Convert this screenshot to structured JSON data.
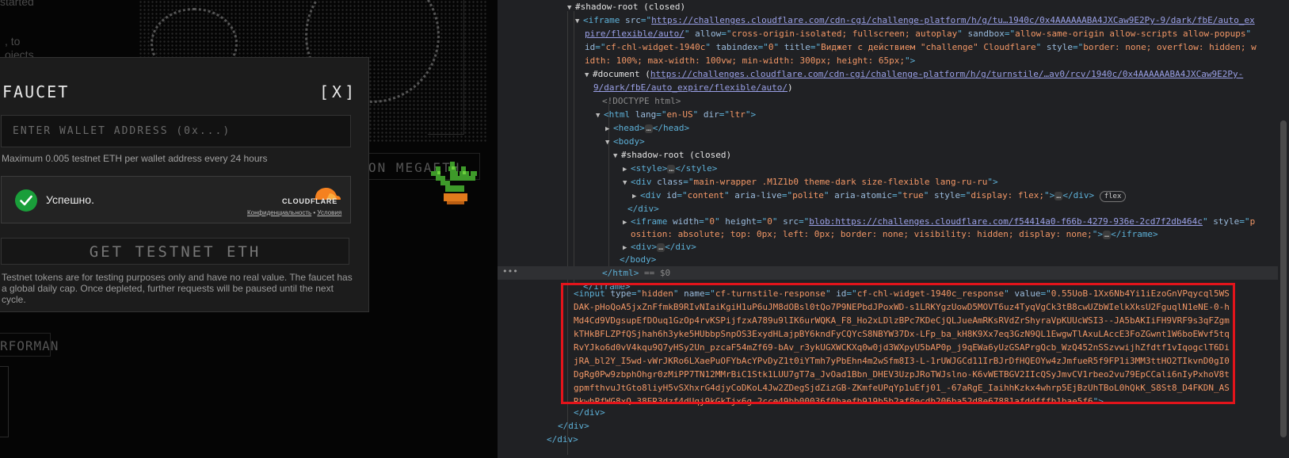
{
  "left_page": {
    "bg_text_a": "started",
    "bg_text_b_line1": ", to",
    "bg_text_b_line2": "ojects",
    "megaeth_button": "ON MEGAETH",
    "perf_button": "RFORMAN",
    "modal": {
      "title": "FAUCET",
      "close_label": "[X]",
      "wallet_placeholder": "ENTER WALLET ADDRESS (0x...)",
      "limit_text": "Maximum 0.005 testnet ETH per wallet address every 24 hours",
      "cf_widget": {
        "status": "Успешно.",
        "logo_text": "CLOUDFLARE",
        "privacy_link": "Конфиденциальность",
        "separator": " • ",
        "terms_link": "Условия"
      },
      "get_button": "GET TESTNET ETH",
      "disclaimer": "Testnet tokens are for testing purposes only and have no real value. The faucet has a global daily cap. Once depleted, further requests will be paused until the next cycle."
    }
  },
  "devtools": {
    "shadow_root_1": "#shadow-root (closed)",
    "iframe_src_1": "https://challenges.cloudflare.com/cdn-cgi/challenge-platform/h/g/tu…1940c/0x4AAAAAABA4JXCaw9E2Py-9/dark/fbE/auto_ex",
    "iframe_src_2": "pire/flexible/auto/",
    "iframe_allow": "cross-origin-isolated; fullscreen; autoplay",
    "iframe_sandbox": "allow-same-origin allow-scripts allow-popups",
    "iframe_id": "cf-chl-widget-1940c",
    "iframe_tabindex": "0",
    "iframe_title": "Виджет с действием \"challenge\" Cloudflare",
    "iframe_style_1": "border: none; overflow: hidden; w",
    "iframe_style_2": "idth: 100%; max-width: 100vw; min-width: 300px; height: 65px;",
    "document_label": "#document",
    "document_url_1": "https://challenges.cloudflare.com/cdn-cgi/challenge-platform/h/g/turnstile/…av0/rcv/1940c/0x4AAAAAABA4JXCaw9E2Py-",
    "document_url_2": "9/dark/fbE/auto_expire/flexible/auto/",
    "doctype": "<!DOCTYPE html>",
    "html_lang": "en-US",
    "html_dir": "ltr",
    "shadow_root_2": "#shadow-root (closed)",
    "div_class": "main-wrapper .M1Z1b0 theme-dark size-flexible lang-ru-ru",
    "content_id": "content",
    "aria_live": "polite",
    "aria_atomic": "true",
    "content_style": "display: flex;",
    "flex_badge": "flex",
    "iframe2_width": "0",
    "iframe2_height": "0",
    "iframe2_src": "blob:https://challenges.cloudflare.com/f54414a0-f66b-4279-936e-2cd7f2db464c",
    "iframe2_style_1": "p",
    "iframe2_style_2": "osition: absolute; top: 0px; left: 0px; border: none; visibility: hidden; display: none;",
    "selected_suffix": " == $0",
    "ellipsis": "…",
    "input": {
      "type": "hidden",
      "name": "cf-turnstile-response",
      "id": "cf-chl-widget-1940c_response",
      "value": "0.55UoB-1Xx6Nb4Yi1iEzoGnVPqycql5WSDAK-pHoQoA5jxZnFfmkB9RIvNIaiKgiH1uP6uJM8dOBsl0tQo7P9NEPbdJPoxWD-s1LRKYgzUowD5MOVT6uz4TyqVgCk3tB8cwUZbWIelkXksU2FguqlN1eNE-0-hMd4Cd9VDgsupEfDOuq1GzOp4rvKSPijfzxA789u9lIK6urWQKA_F8_Ho2xLDlzBPc7KDeCjQLJueAmRKsRVdZrShyraVpKUUcWSI3--JA5bAKIiFH9VRF9s3qFZgmkTHkBFLZPfQSjhah6h3yke5HUbbpSnpOS3ExydHLajpBY6kndFyCQYcS8NBYW37Dx-LFp_ba_kH8K9Xx7eq3GzN9QL1EwgwTlAxuLAccE3FoZGwnt1W6boEWvf5tqRvYJko6d0vV4kqu9Q7yHSy2Un_pzcaF54mZf69-bAv_r3ykUGXWCKXq0w0jd3WXpyU5bAP0p_j9qEWa6yUzGSAPrgQcb_WzQ452nSSzvwijhZfdtf1vIqogclT6DijRA_bl2Y_I5wd-vWrJKRo6LXaePuOFYbAcYPvDyZ1t0iYTmh7yPbEhn4m2wSfm8I3-L-1rUWJGCd11IrBJrDfHQEOYw4zJmfueR5f9FP1i3MM3ttHO2TIkvnD0gI0DgRg0Pw9zbphOhgr0zMiPP7TN12MMrBiC1Stk1LUU7gT7a_JvOad1Bbn_DHEV3UzpJRoTWJslno-K6vWETBGV2IIcQSyJmvCV1rbeo2vu79EpCCali6nIyPxhoV8tgpmfthvuJtGto8liyH5vSXhxrG4djyCoDKoL4Jw2ZDegSjdZizGB-ZKmfeUPqYp1uEfj01_-67aRgE_IaihhKzkx4whrp5EjBzUhTBoL0hQkK_S8St8_D4FKDN_ASRkwhPfWG8xQ.38ER3dzf4dUqj9kGkTjx6g.2cce49bb00036f0baefb919b5b2af8ecdb206ba52d8e67881afddfffb1bae5f6"
    }
  }
}
